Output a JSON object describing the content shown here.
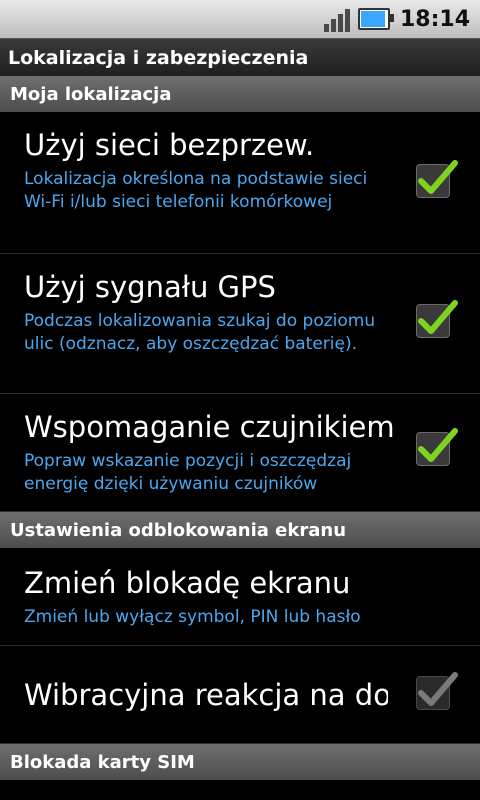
{
  "status_bar": {
    "time": "18:14",
    "signal_icon": "signal-bars-icon",
    "battery_icon": "battery-icon",
    "battery_fill": 0.85
  },
  "title": "Lokalizacja i zabezpieczenia",
  "sections": [
    {
      "header": "Moja lokalizacja"
    },
    {
      "header": "Ustawienia odblokowania ekranu"
    },
    {
      "header": "Blokada karty SIM"
    }
  ],
  "items": [
    {
      "title": "Użyj sieci bezprzew.",
      "summary": "Lokalizacja określona na podstawie sieci Wi-Fi i/lub sieci telefonii komórkowej",
      "checked": true
    },
    {
      "title": "Użyj sygnału GPS",
      "summary": "Podczas lokalizowania szukaj do poziomu ulic (odznacz, aby oszczędzać baterię).",
      "checked": true
    },
    {
      "title": "Wspomaganie czujnikiem",
      "summary": "Popraw wskazanie pozycji i oszczędzaj energię dzięki używaniu czujników",
      "checked": true
    },
    {
      "title": "Zmień blokadę ekranu",
      "summary": "Zmień lub wyłącz symbol, PIN lub hasło"
    },
    {
      "title": "Wibracyjna reakcja na dotyk",
      "checked": true,
      "enabled": false
    }
  ],
  "colors": {
    "summary": "#4aa8f0",
    "check": "#7ed321",
    "check_disabled": "#7a7a7a"
  }
}
